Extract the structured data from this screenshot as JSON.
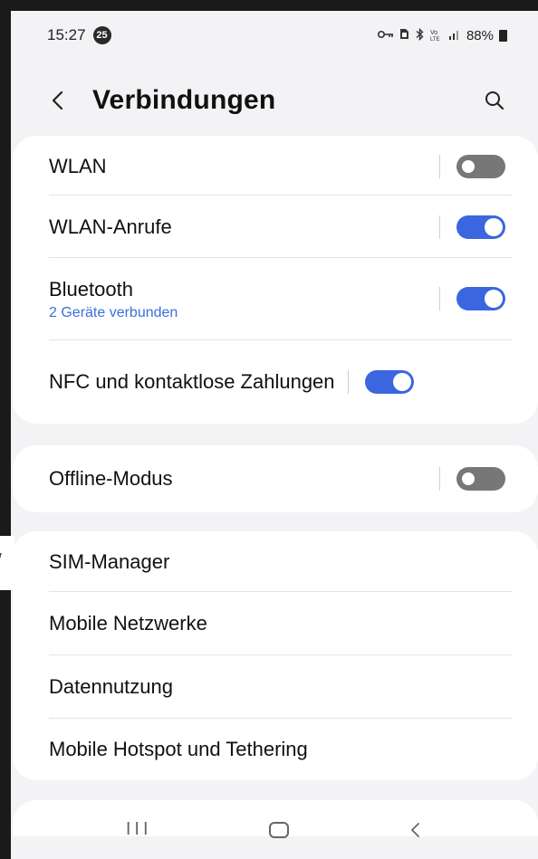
{
  "status_bar": {
    "time": "15:27",
    "notification_count": "25",
    "battery": "88%",
    "icons": [
      "key-icon",
      "sim-icon",
      "bluetooth-icon",
      "volte-icon",
      "signal-icon",
      "battery-icon"
    ]
  },
  "header": {
    "title": "Verbindungen",
    "back_icon": "chevron-left-icon",
    "search_icon": "search-icon"
  },
  "group1": [
    {
      "label": "WLAN",
      "toggle": "off"
    },
    {
      "label": "WLAN-Anrufe",
      "toggle": "on"
    },
    {
      "label": "Bluetooth",
      "sublabel": "2 Geräte verbunden",
      "toggle": "on"
    },
    {
      "label": "NFC und kontaktlose Zahlungen",
      "toggle": "on"
    }
  ],
  "group2": [
    {
      "label": "Offline-Modus",
      "toggle": "off"
    }
  ],
  "group3": [
    {
      "label": "SIM-Manager"
    },
    {
      "label": "Mobile Netzwerke"
    },
    {
      "label": "Datennutzung"
    },
    {
      "label": "Mobile Hotspot und Tethering"
    }
  ],
  "navbar": {
    "recents_label": "III",
    "icons": [
      "recents-icon",
      "home-icon",
      "back-icon"
    ]
  },
  "colors": {
    "accent": "#3b66e0",
    "sublabel": "#3a6fd8",
    "background": "#f3f3f6",
    "card": "#ffffff"
  }
}
